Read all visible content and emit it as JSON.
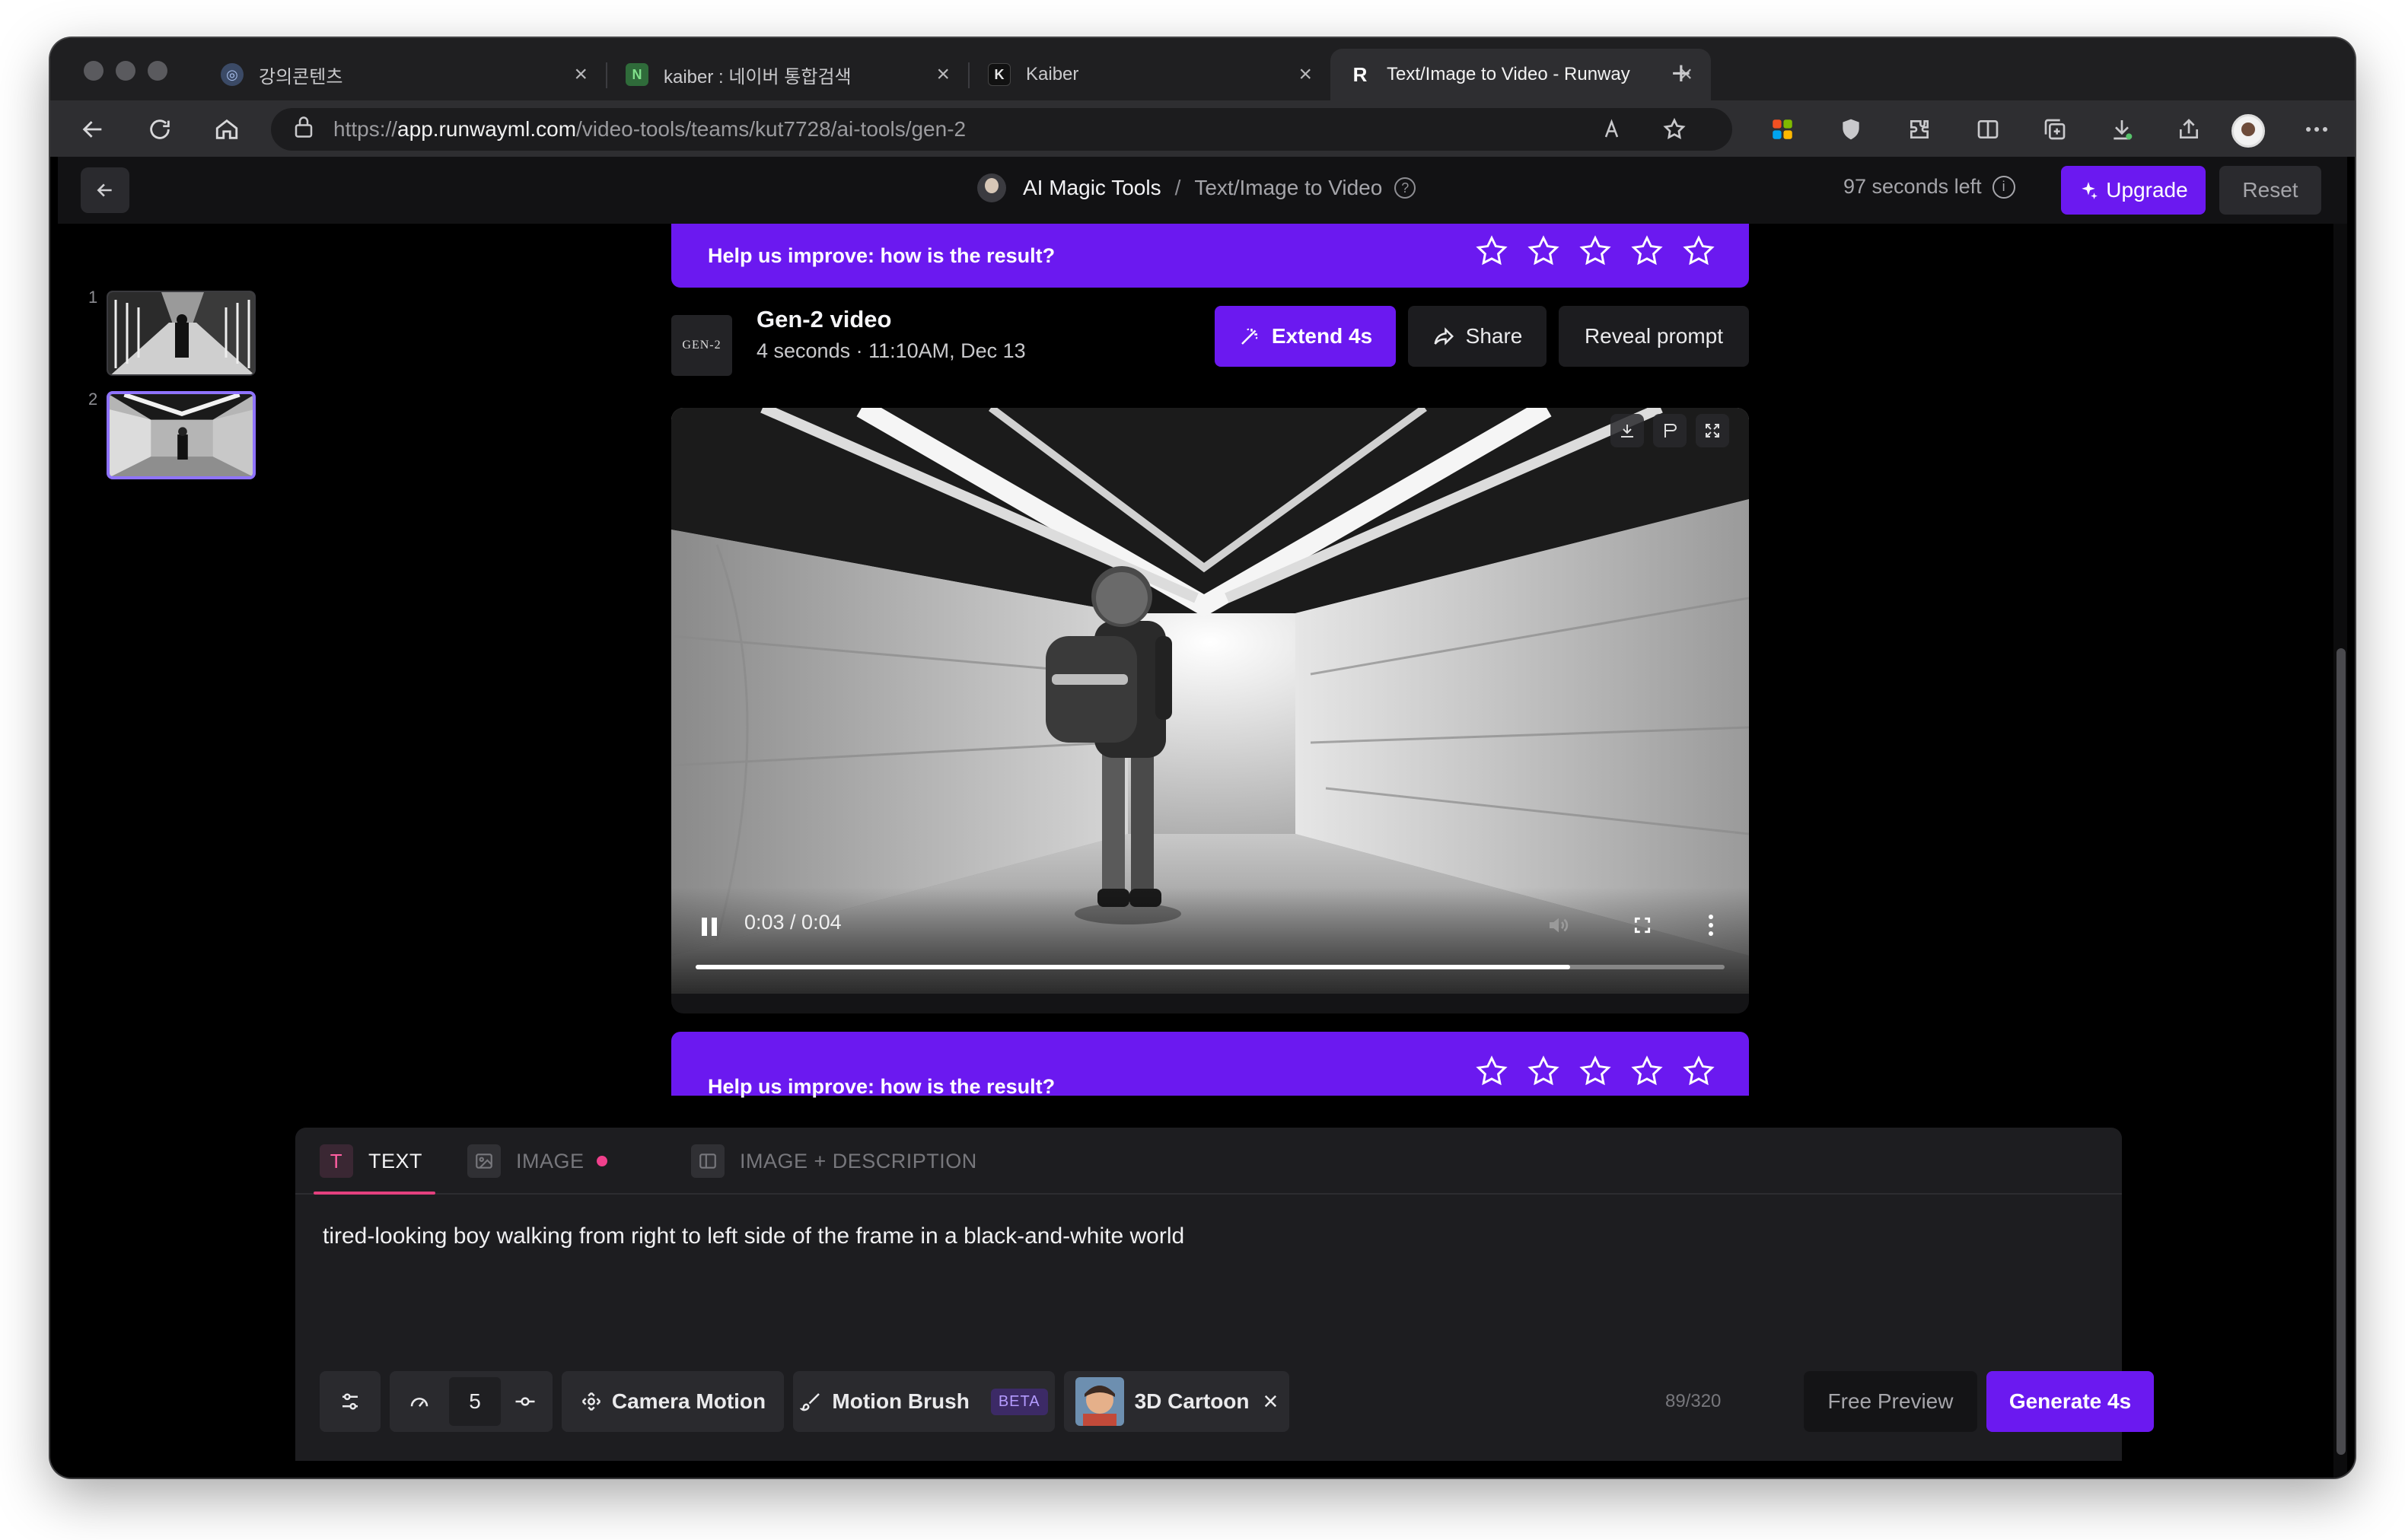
{
  "browser": {
    "tabs": [
      {
        "label": "강의콘텐츠",
        "favicon": "globe-icon"
      },
      {
        "label": "kaiber : 네이버 통합검색",
        "favicon": "naver-icon"
      },
      {
        "label": "Kaiber",
        "favicon": "kaiber-icon"
      },
      {
        "label": "Text/Image to Video - Runway",
        "favicon": "runway-icon"
      }
    ],
    "url": {
      "scheme": "https://",
      "host": "app.runwayml.com",
      "path": "/video-tools/teams/kut7728/ai-tools/gen-2"
    }
  },
  "app": {
    "breadcrumb": {
      "parent": "AI Magic Tools",
      "separator": "/",
      "current": "Text/Image to Video"
    },
    "credits": "97 seconds left",
    "upgrade_label": "Upgrade",
    "reset_label": "Reset",
    "thumbnails": [
      {
        "index": "1"
      },
      {
        "index": "2",
        "selected": true
      }
    ],
    "rating_prompt": "Help us improve: how is the result?",
    "rating_prompt_partial": "Help us improve: how is the result?",
    "video_card": {
      "logo_text": "GEN-2",
      "title": "Gen-2 video",
      "meta": "4 seconds · 11:10AM, Dec 13",
      "extend_label": "Extend 4s",
      "share_label": "Share",
      "reveal_label": "Reveal prompt"
    },
    "player": {
      "time": "0:03 / 0:04",
      "progress_fraction": 0.85
    },
    "prompt_panel": {
      "tabs": [
        {
          "label": "TEXT",
          "icon": "T"
        },
        {
          "label": "IMAGE"
        },
        {
          "label": "IMAGE + DESCRIPTION"
        }
      ],
      "prompt_text": "tired-looking boy walking from right to left side of the frame in a black-and-white world",
      "motion_value": "5",
      "camera_motion_label": "Camera Motion",
      "motion_brush_label": "Motion Brush",
      "beta_label": "BETA",
      "style_label": "3D Cartoon",
      "char_count": "89/320",
      "free_preview_label": "Free Preview",
      "generate_label": "Generate 4s"
    },
    "colors": {
      "accent": "#6b19f0",
      "pink": "#f0408c",
      "background": "#000000"
    }
  }
}
